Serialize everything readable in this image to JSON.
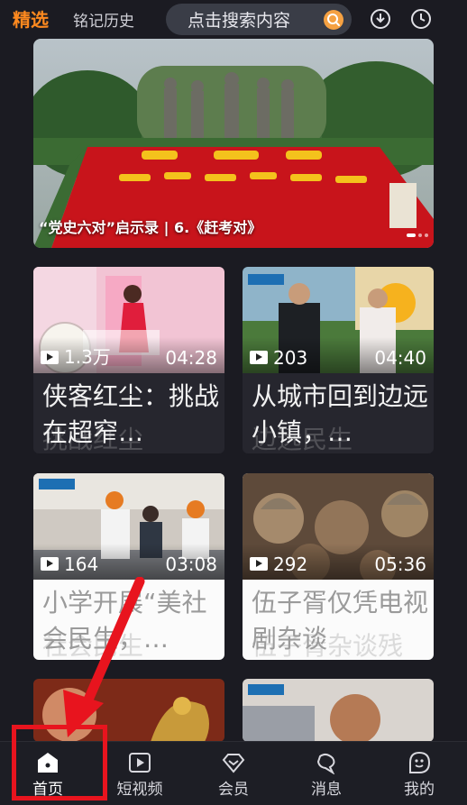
{
  "header": {
    "tab_active": "精选",
    "tab_history": "铭记历史",
    "search_placeholder": "点击搜索内容",
    "icons": [
      "download-icon",
      "history-clock-icon"
    ]
  },
  "hero": {
    "caption": "“党史六对”启示录 | 6.《赶考对》",
    "dots": 3
  },
  "cards": [
    {
      "views": "1.3万",
      "duration": "04:28",
      "title": "侠客红尘：挑战在超窄…",
      "ghost": "挑战红尘",
      "theme": "dark"
    },
    {
      "views": "203",
      "duration": "04:40",
      "title": "从城市回到边远小镇，…",
      "ghost": "边远民生",
      "theme": "dark"
    },
    {
      "views": "164",
      "duration": "03:08",
      "title": "小学开展“美社会民生，…",
      "ghost": "社会民生",
      "theme": "light"
    },
    {
      "views": "292",
      "duration": "05:36",
      "title": "伍子胥仅凭电视剧杂谈",
      "ghost": "伍子胥杂谈残",
      "theme": "light"
    }
  ],
  "bottom_nav": [
    {
      "label": "首页",
      "icon": "home-icon",
      "active": true
    },
    {
      "label": "短视频",
      "icon": "short-video-icon",
      "active": false
    },
    {
      "label": "会员",
      "icon": "vip-diamond-icon",
      "active": false
    },
    {
      "label": "消息",
      "icon": "message-icon",
      "active": false
    },
    {
      "label": "我的",
      "icon": "profile-icon",
      "active": false
    }
  ],
  "colors": {
    "accent": "#ff8a1f",
    "background": "#1b1b22",
    "annotation": "#e8141e"
  }
}
